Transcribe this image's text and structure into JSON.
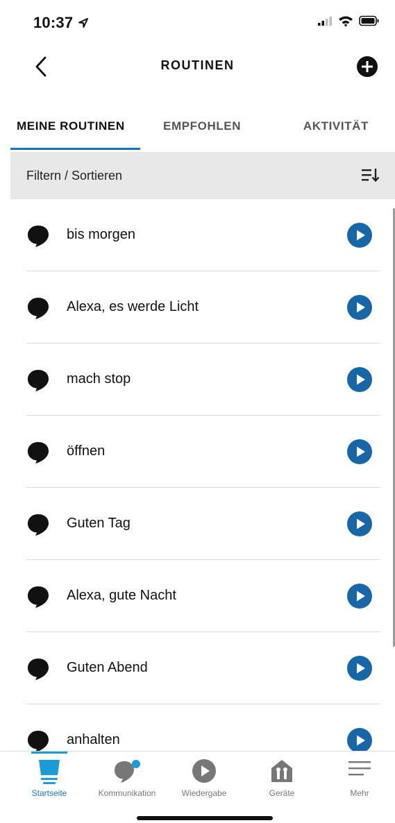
{
  "status_bar": {
    "time": "10:37"
  },
  "header": {
    "title": "ROUTINEN"
  },
  "tabs": [
    {
      "label": "MEINE ROUTINEN",
      "active": true
    },
    {
      "label": "EMPFOHLEN",
      "active": false
    },
    {
      "label": "AKTIVITÄT",
      "active": false
    }
  ],
  "filter": {
    "label": "Filtern / Sortieren"
  },
  "routines": [
    {
      "label": "bis morgen"
    },
    {
      "label": "Alexa, es werde Licht"
    },
    {
      "label": "mach stop"
    },
    {
      "label": "öffnen"
    },
    {
      "label": "Guten Tag"
    },
    {
      "label": "Alexa, gute Nacht"
    },
    {
      "label": "Guten Abend"
    },
    {
      "label": "anhalten"
    }
  ],
  "bottom_nav": [
    {
      "label": "Startseite",
      "icon": "home-icon",
      "active": true
    },
    {
      "label": "Kommunikation",
      "icon": "chat-icon",
      "active": false
    },
    {
      "label": "Wiedergabe",
      "icon": "play-icon",
      "active": false
    },
    {
      "label": "Geräte",
      "icon": "devices-icon",
      "active": false
    },
    {
      "label": "Mehr",
      "icon": "menu-icon",
      "active": false
    }
  ],
  "colors": {
    "accent": "#1a73b8",
    "play_button": "#1766a8",
    "filter_bar_bg": "#e8e8e8"
  }
}
